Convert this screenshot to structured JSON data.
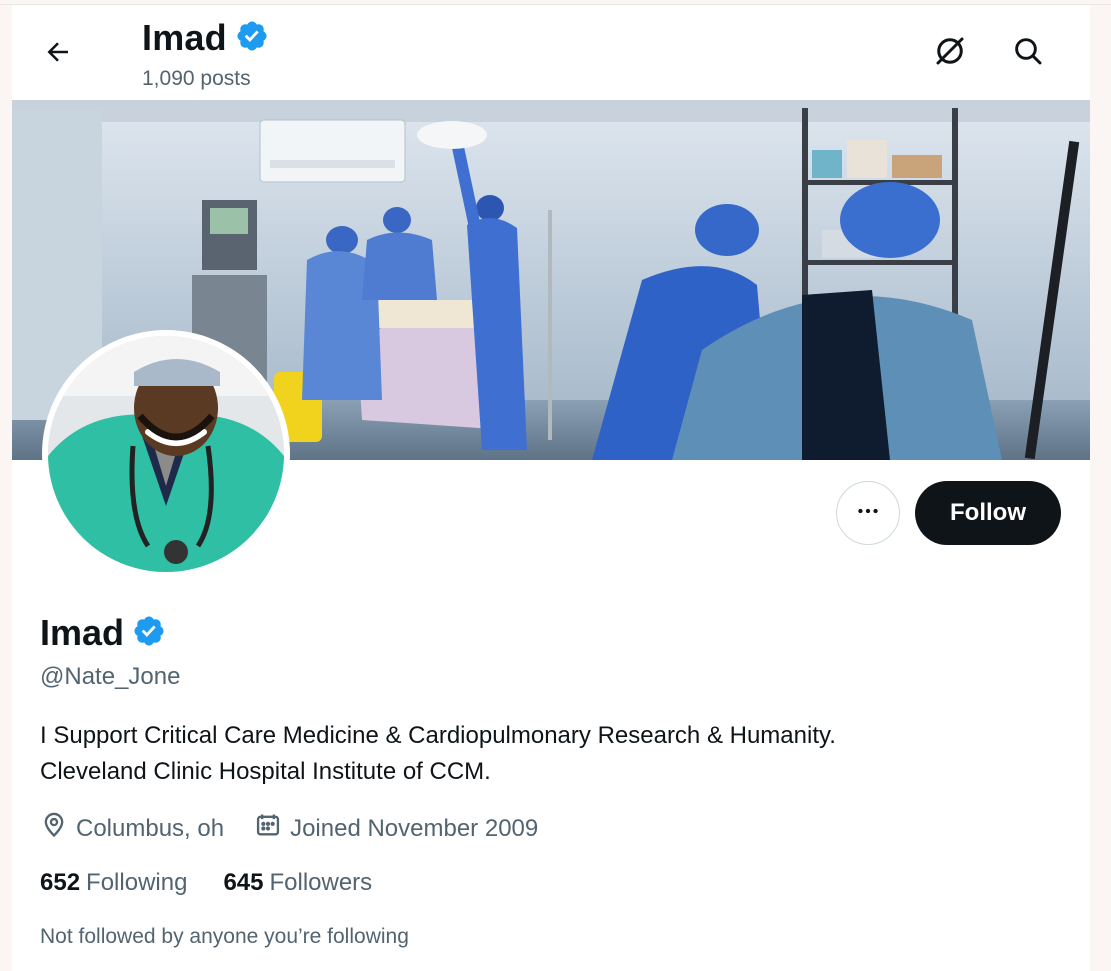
{
  "header": {
    "back_icon": "arrow-left-icon",
    "name": "Imad",
    "posts": "1,090 posts",
    "subscribe_icon": "no-notifications-icon",
    "search_icon": "search-icon"
  },
  "banner": {
    "alt": "operating-room-photo"
  },
  "avatar": {
    "alt": "profile-photo"
  },
  "actions": {
    "more_label": "•••",
    "follow_label": "Follow"
  },
  "profile": {
    "name": "Imad",
    "verified": true,
    "handle": "@Nate_Jone",
    "bio_line1": "I Support Critical Care Medicine & Cardiopulmonary Research & Humanity.",
    "bio_line2": "Cleveland Clinic Hospital Institute of CCM.",
    "location": "Columbus, oh",
    "joined": "Joined November 2009",
    "following_count": "652",
    "following_label": "Following",
    "followers_count": "645",
    "followers_label": "Followers",
    "mutuals_note": "Not followed by anyone you’re following"
  },
  "colors": {
    "verified_blue": "#1d9bf0",
    "text_primary": "#0f1419",
    "text_secondary": "#536471",
    "follow_bg": "#0f1419"
  }
}
